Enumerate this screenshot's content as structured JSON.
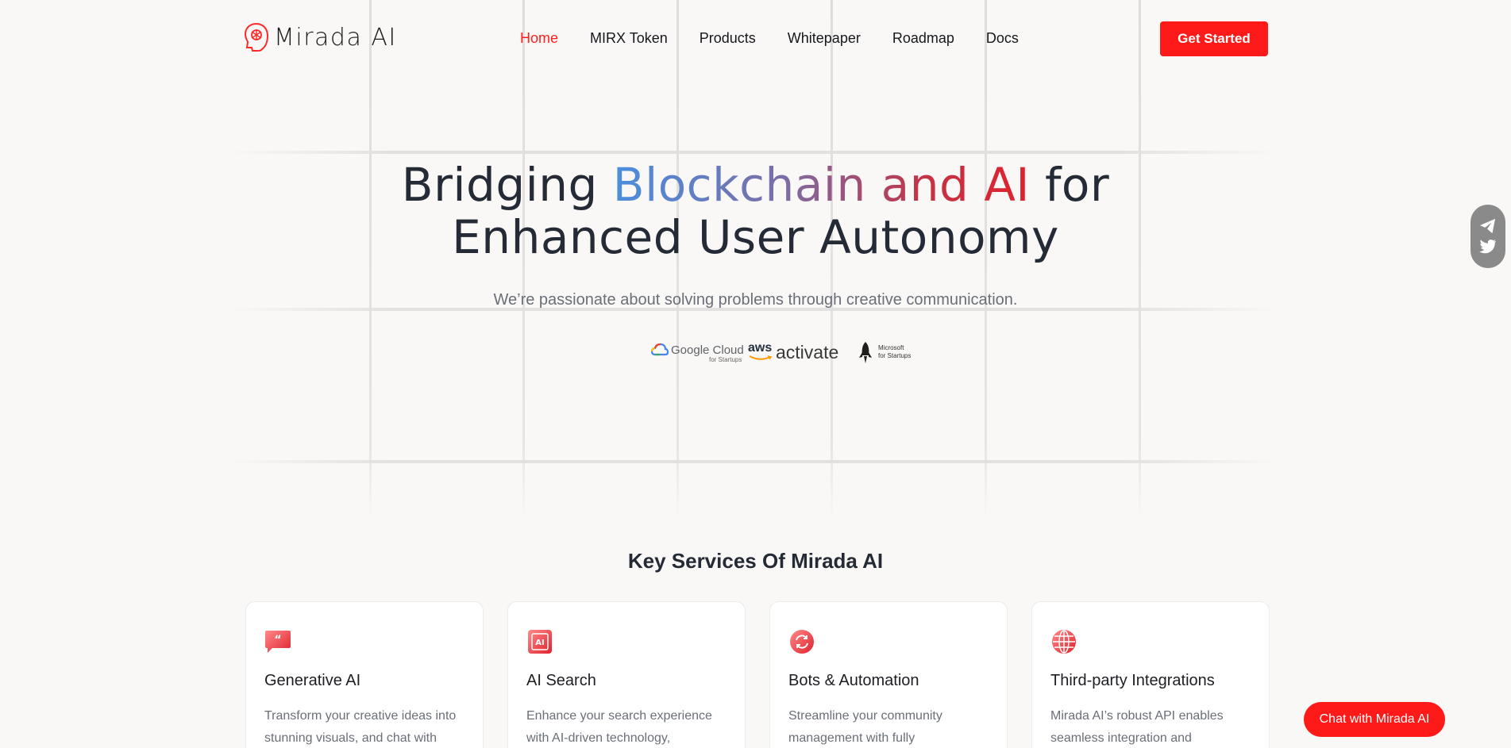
{
  "header": {
    "logo_text": "Mirada AI",
    "nav": [
      "Home",
      "MIRX Token",
      "Products",
      "Whitepaper",
      "Roadmap",
      "Docs"
    ],
    "active_nav": "Home",
    "cta_label": "Get Started"
  },
  "hero": {
    "title_part1": "Bridging ",
    "title_highlight": "Blockchain and AI",
    "title_part2": " for",
    "title_line2": "Enhanced User Autonomy",
    "subtitle": "We’re passionate about solving problems through creative communication.",
    "partners": {
      "google": "Google Cloud",
      "google_sub": "for Startups",
      "aws": "aws",
      "activate": "activate",
      "ms_line1": "Microsoft",
      "ms_line2": "for Startups"
    }
  },
  "social": {
    "icons": [
      "telegram-icon",
      "twitter-icon"
    ]
  },
  "services": {
    "title": "Key Services Of Mirada AI",
    "cards": [
      {
        "title": "Generative AI",
        "text": "Transform your creative ideas into stunning visuals, and chat with",
        "icon": "quote-bubble-icon"
      },
      {
        "title": "AI Search",
        "text": "Enhance your search experience with AI-driven technology,",
        "icon": "ai-chip-icon"
      },
      {
        "title": "Bots & Automation",
        "text": "Streamline your community management with fully",
        "icon": "refresh-icon"
      },
      {
        "title": "Third-party Integrations",
        "text": "Mirada AI’s robust API enables seamless integration and",
        "icon": "globe-icon"
      }
    ]
  },
  "chat_label": "Chat with Mirada AI",
  "colors": {
    "accent": "#ff1a1a",
    "gradient_start": "#4a8ede",
    "gradient_end": "#e0222d",
    "text": "#252b36"
  }
}
